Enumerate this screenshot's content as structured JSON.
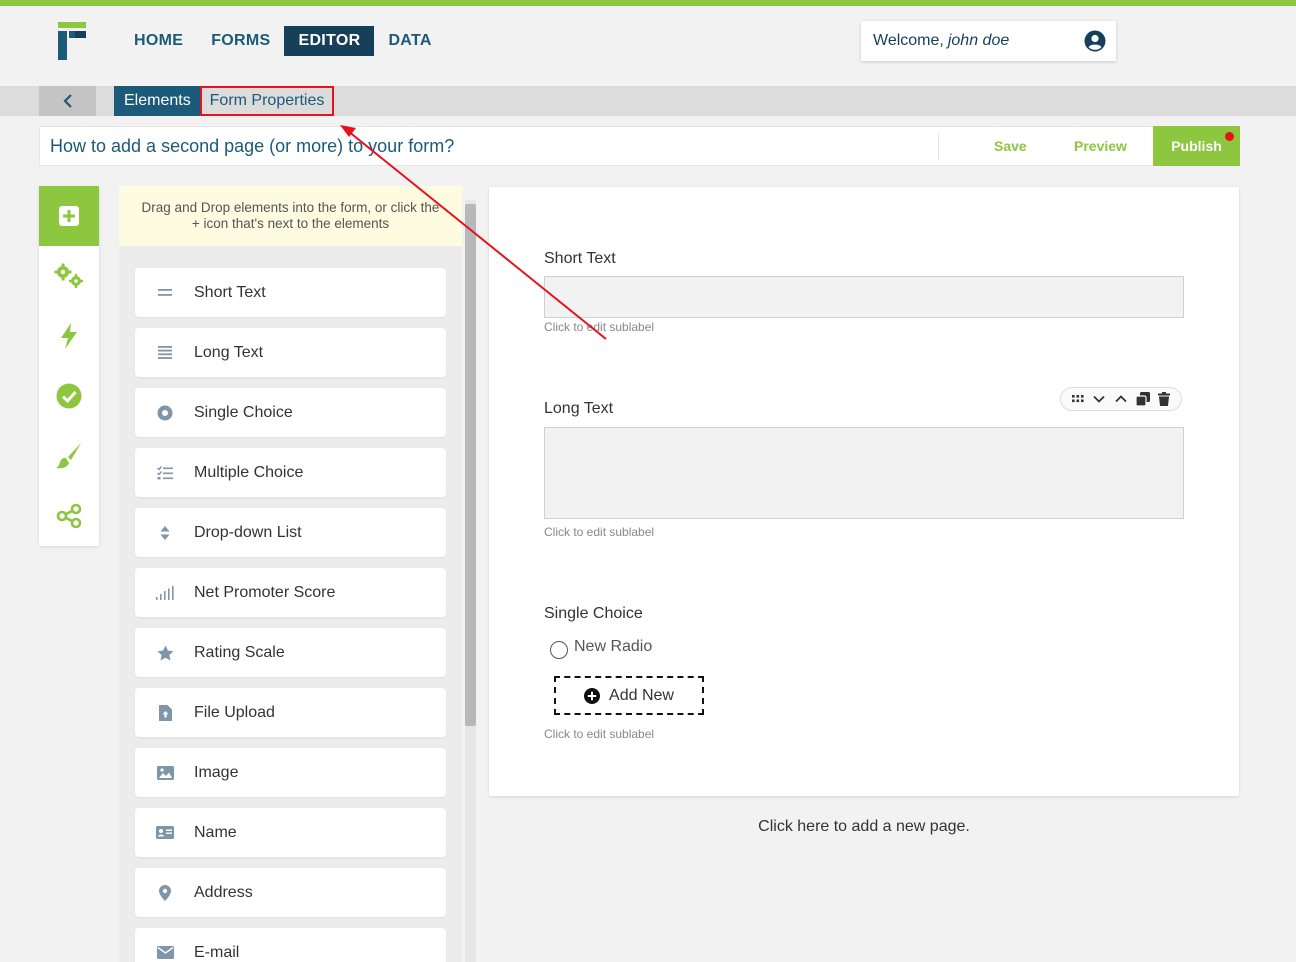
{
  "header": {
    "nav": [
      {
        "label": "HOME",
        "active": false
      },
      {
        "label": "FORMS",
        "active": false
      },
      {
        "label": "EDITOR",
        "active": true
      },
      {
        "label": "DATA",
        "active": false
      }
    ],
    "welcome_prefix": "Welcome,",
    "welcome_user": "john doe"
  },
  "subbar": {
    "tab_elements": "Elements",
    "tab_form_properties": "Form Properties"
  },
  "titlebar": {
    "form_title": "How to add a second page (or more) to your form?",
    "save_label": "Save",
    "preview_label": "Preview",
    "publish_label": "Publish"
  },
  "sidebar_icons": [
    "add-element-icon",
    "settings-gears-icon",
    "lightning-icon",
    "check-circle-icon",
    "paintbrush-icon",
    "share-icon"
  ],
  "panel": {
    "hint": "Drag and Drop elements into the form, or click the + icon that's next to the elements",
    "elements": [
      {
        "label": "Short Text",
        "icon": "short-text-icon"
      },
      {
        "label": "Long Text",
        "icon": "long-text-icon"
      },
      {
        "label": "Single Choice",
        "icon": "radio-icon"
      },
      {
        "label": "Multiple Choice",
        "icon": "checklist-icon"
      },
      {
        "label": "Drop-down List",
        "icon": "dropdown-icon"
      },
      {
        "label": "Net Promoter Score",
        "icon": "signal-bars-icon"
      },
      {
        "label": "Rating Scale",
        "icon": "star-icon"
      },
      {
        "label": "File Upload",
        "icon": "file-upload-icon"
      },
      {
        "label": "Image",
        "icon": "image-icon"
      },
      {
        "label": "Name",
        "icon": "id-card-icon"
      },
      {
        "label": "Address",
        "icon": "map-pin-icon"
      },
      {
        "label": "E-mail",
        "icon": "envelope-icon"
      }
    ]
  },
  "canvas": {
    "short_text_label": "Short Text",
    "short_text_sublabel": "Click to edit sublabel",
    "long_text_label": "Long Text",
    "long_text_sublabel": "Click to edit sublabel",
    "single_choice_label": "Single Choice",
    "radio_option": "New Radio",
    "add_new_label": "Add New",
    "single_choice_sublabel": "Click to edit sublabel",
    "add_page_label": "Click here to add a new page."
  },
  "colors": {
    "accent_green": "#8dc63f",
    "brand_navy": "#163f5a",
    "brand_blue": "#1b5a78",
    "annotation_red": "#e8111c"
  }
}
